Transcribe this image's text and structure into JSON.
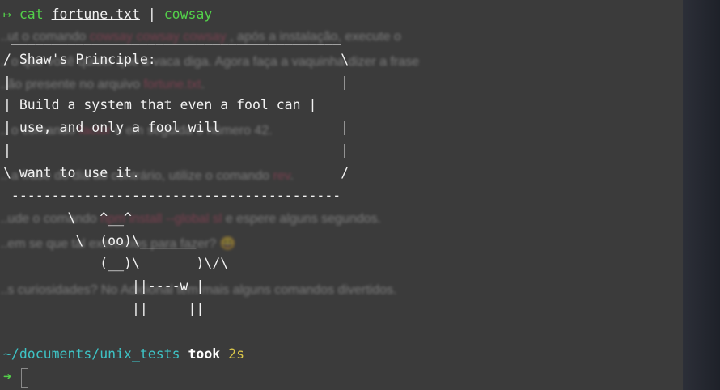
{
  "terminal": {
    "prompt_arrow": "↦",
    "command": {
      "cmd": "cat",
      "file": "fortune.txt",
      "pipe": "|",
      "pipe_cmd": "cowsay"
    },
    "output": [
      " _________________________________________",
      "/ Shaw's Principle:                       \\",
      "|                                         |",
      "| Build a system that even a fool can |",
      "| use, and only a fool will               |",
      "|                                         |",
      "\\ want to use it.                         /",
      " -----------------------------------------",
      "        \\   ^__^",
      "         \\  (oo)\\_______",
      "            (__)\\       )\\/\\",
      "                ||----w |",
      "                ||     ||"
    ],
    "status": {
      "path": "~/documents/unix_tests",
      "took_label": "took",
      "duration": "2s"
    },
    "next_prompt_arrow": "➜"
  },
  "background_doc": {
    "lines": [
      {
        "text": "...ut o comando",
        "pink": "cowsay cowsay cowsay",
        "rest": ", após a instalação, execute o"
      },
      {
        "text": "...  o que você quiser que a vaca diga. Agora faça a vaquinha dizer a frase"
      },
      {
        "text": "...ão presente no arquivo",
        "pink": "fortune.txt",
        "rest": "."
      },
      {
        "text": "...                          o comando",
        "pink": "factor",
        "rest": "e em seguida o número 42."
      },
      {
        "text": "...  a frase do dia ao contrário, utilize o comando",
        "pink": "rev",
        "rest": "."
      },
      {
        "text": "...ude o comando",
        "pink": "npm install --global sl",
        "rest": "e espere alguns segundos."
      },
      {
        "text": "...em se que tal exercícios para fazer? 😀"
      },
      {
        "text": "...s curiosidades? No Adicional tem mais alguns comandos divertidos."
      }
    ],
    "colors": {
      "accent": "#e24a72"
    }
  },
  "colors": {
    "prompt_green": "#53d04a",
    "path_cyan": "#3ec3c5",
    "duration_yellow": "#d9c64a",
    "terminal_bg": "#3b3b3b"
  }
}
